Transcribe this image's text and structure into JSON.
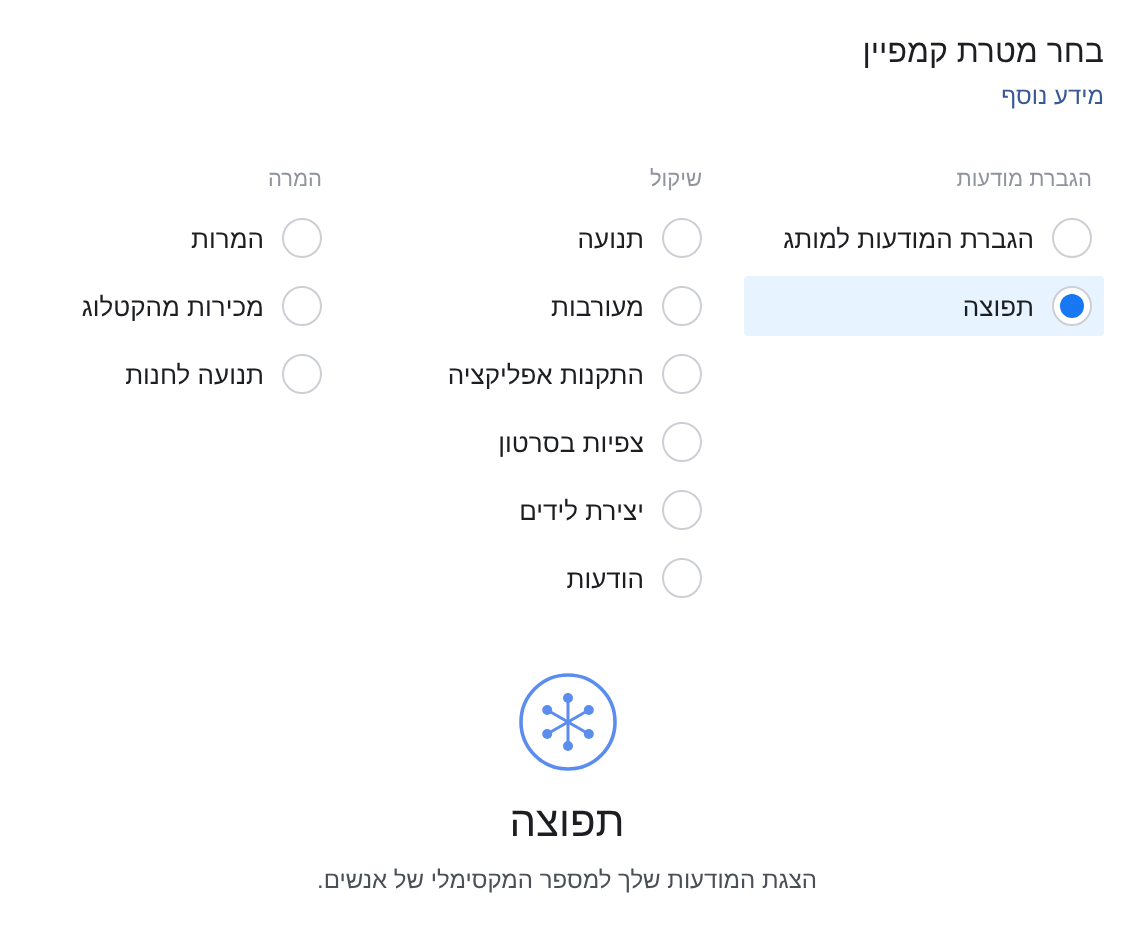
{
  "title": "בחר מטרת קמפיין",
  "link": "מידע נוסף",
  "groups": [
    {
      "header": "הגברת מודעות",
      "options": [
        {
          "label": "הגברת המודעות למותג",
          "selected": false
        },
        {
          "label": "תפוצה",
          "selected": true
        }
      ]
    },
    {
      "header": "שיקול",
      "options": [
        {
          "label": "תנועה",
          "selected": false
        },
        {
          "label": "מעורבות",
          "selected": false
        },
        {
          "label": "התקנות אפליקציה",
          "selected": false
        },
        {
          "label": "צפיות בסרטון",
          "selected": false
        },
        {
          "label": "יצירת לידים",
          "selected": false
        },
        {
          "label": "הודעות",
          "selected": false
        }
      ]
    },
    {
      "header": "המרה",
      "options": [
        {
          "label": "המרות",
          "selected": false
        },
        {
          "label": "מכירות מהקטלוג",
          "selected": false
        },
        {
          "label": "תנועה לחנות",
          "selected": false
        }
      ]
    }
  ],
  "summary": {
    "title": "תפוצה",
    "description": "הצגת המודעות שלך למספר המקסימלי של אנשים."
  }
}
